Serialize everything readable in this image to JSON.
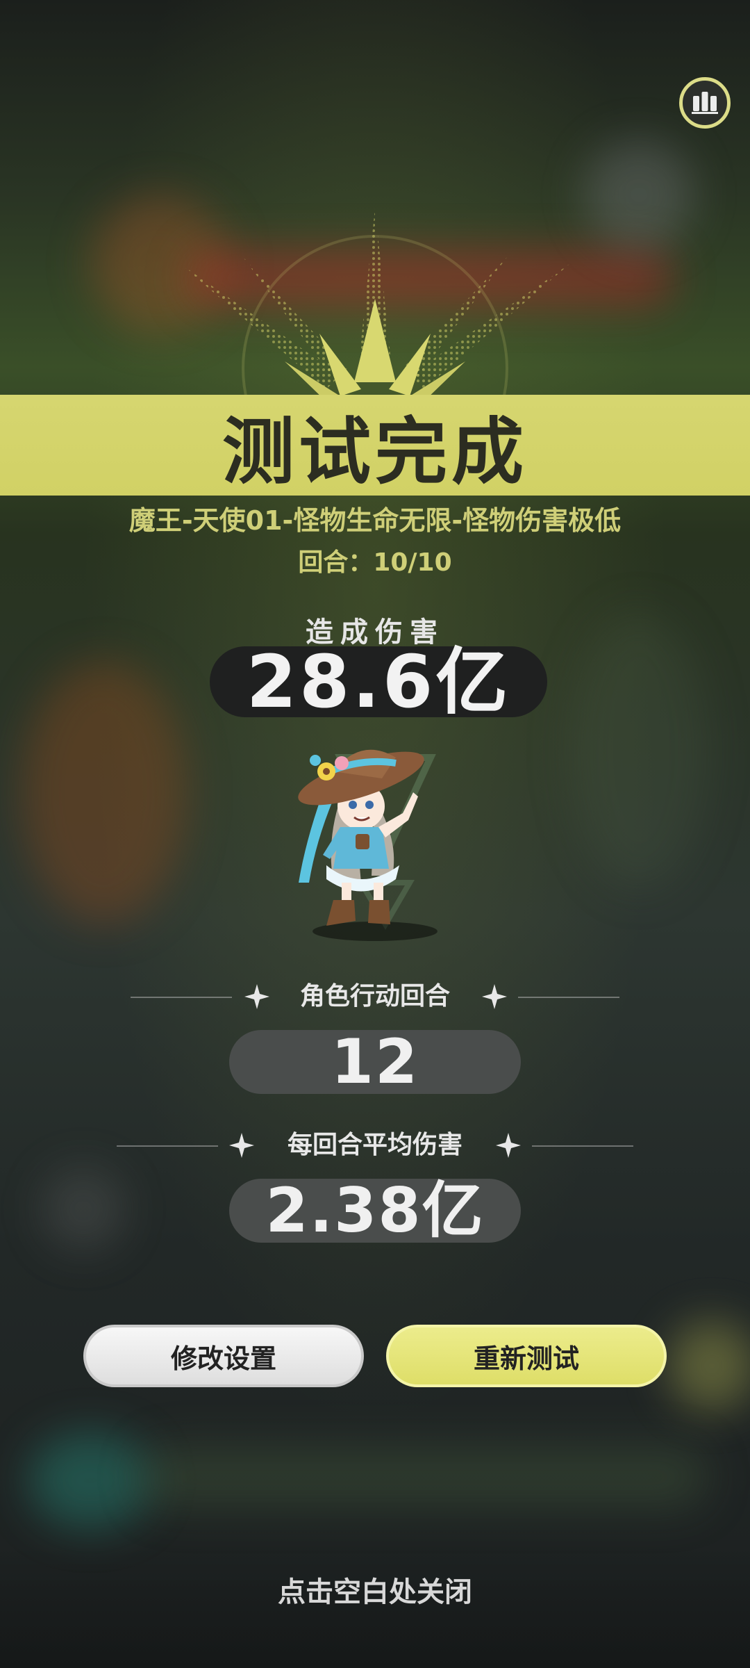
{
  "result": {
    "title": "测试完成",
    "subtitle": "魔王-天使01-怪物生命无限-怪物伤害极低",
    "round": "回合：10/10"
  },
  "damage": {
    "label": "造成伤害",
    "value": "28.6亿"
  },
  "stats": [
    {
      "label": "角色行动回合",
      "value": "12"
    },
    {
      "label": "每回合平均伤害",
      "value": "2.38亿"
    }
  ],
  "buttons": {
    "modify": "修改设置",
    "retest": "重新测试"
  },
  "footer": {
    "close_hint": "点击空白处关闭"
  },
  "icons": {
    "top_right": "bar-chart-icon",
    "stat_decor": "sparkle-icon"
  },
  "colors": {
    "accent": "#d6d670",
    "accent_text": "#cfcf78",
    "dark_pill": "#1f2020",
    "stat_pill": "#4a4d4c"
  }
}
